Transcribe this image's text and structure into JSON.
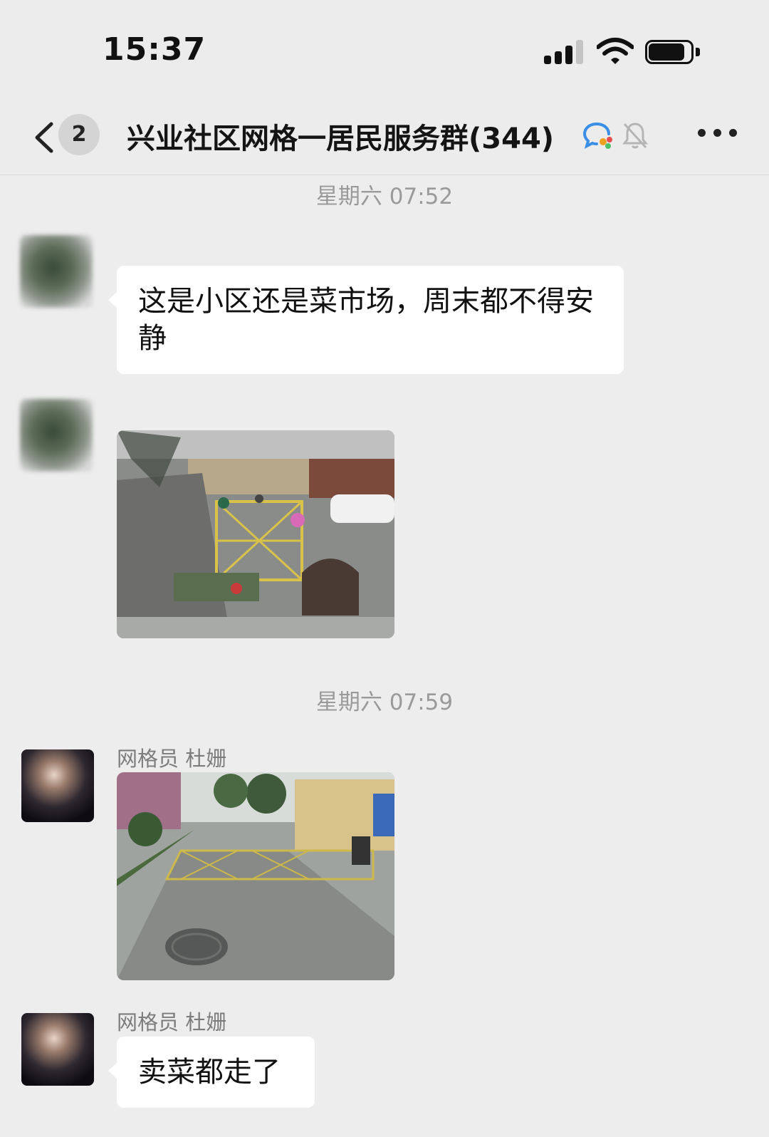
{
  "status_bar": {
    "time": "15:37"
  },
  "nav": {
    "unread_count": "2",
    "title": "兴业社区网格一居民服务群(344)"
  },
  "messages": [
    {
      "timestamp": "星期六 07:52"
    },
    {
      "text": "这是小区还是菜市场，周末都不得安静"
    },
    {
      "timestamp": "星期六 07:59"
    },
    {
      "sender": "网格员  杜姗"
    },
    {
      "sender": "网格员  杜姗",
      "text": "卖菜都走了"
    }
  ]
}
